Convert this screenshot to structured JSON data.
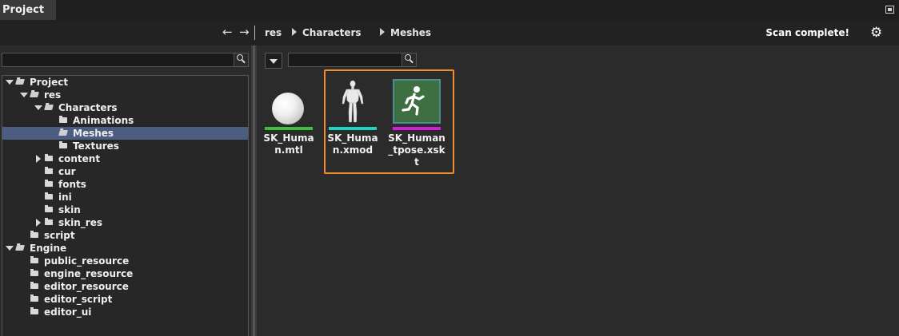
{
  "panel": {
    "title": "Project"
  },
  "nav": {
    "back_label": "←",
    "forward_label": "→",
    "breadcrumb": [
      "res",
      "Characters",
      "Meshes"
    ],
    "status": "Scan complete!"
  },
  "left_search": {
    "value": "",
    "placeholder": ""
  },
  "tree": [
    {
      "label": "Project",
      "level": 0,
      "state": "expanded",
      "selected": false
    },
    {
      "label": "res",
      "level": 1,
      "state": "expanded",
      "selected": false
    },
    {
      "label": "Characters",
      "level": 2,
      "state": "expanded",
      "selected": false
    },
    {
      "label": "Animations",
      "level": 3,
      "state": "leaf",
      "selected": false
    },
    {
      "label": "Meshes",
      "level": 3,
      "state": "leaf",
      "selected": true
    },
    {
      "label": "Textures",
      "level": 3,
      "state": "leaf",
      "selected": false
    },
    {
      "label": "content",
      "level": 2,
      "state": "collapsed",
      "selected": false
    },
    {
      "label": "cur",
      "level": 2,
      "state": "leaf",
      "selected": false
    },
    {
      "label": "fonts",
      "level": 2,
      "state": "leaf",
      "selected": false
    },
    {
      "label": "ini",
      "level": 2,
      "state": "leaf",
      "selected": false
    },
    {
      "label": "skin",
      "level": 2,
      "state": "leaf",
      "selected": false
    },
    {
      "label": "skin_res",
      "level": 2,
      "state": "collapsed",
      "selected": false
    },
    {
      "label": "script",
      "level": 1,
      "state": "leaf",
      "selected": false
    },
    {
      "label": "Engine",
      "level": 0,
      "state": "expanded",
      "selected": false
    },
    {
      "label": "public_resource",
      "level": 1,
      "state": "leaf",
      "selected": false
    },
    {
      "label": "engine_resource",
      "level": 1,
      "state": "leaf",
      "selected": false
    },
    {
      "label": "editor_resource",
      "level": 1,
      "state": "leaf",
      "selected": false
    },
    {
      "label": "editor_script",
      "level": 1,
      "state": "leaf",
      "selected": false
    },
    {
      "label": "editor_ui",
      "level": 1,
      "state": "leaf",
      "selected": false
    }
  ],
  "right_search": {
    "value": "",
    "placeholder": ""
  },
  "assets": [
    {
      "name": "SK_Human.mtl",
      "icon": "material-sphere-icon",
      "bar_color": "#3fbf3f",
      "selected": false
    },
    {
      "name": "SK_Human.xmod",
      "icon": "mesh-figure-icon",
      "bar_color": "#1fd3c4",
      "selected": true
    },
    {
      "name": "SK_Human_tpose.xskt",
      "icon": "skeleton-runner-icon",
      "bar_color": "#d41fd8",
      "selected": true
    }
  ],
  "colors": {
    "selection_outline": "#f08c2a",
    "tree_selected_bg": "#4b5d80"
  }
}
